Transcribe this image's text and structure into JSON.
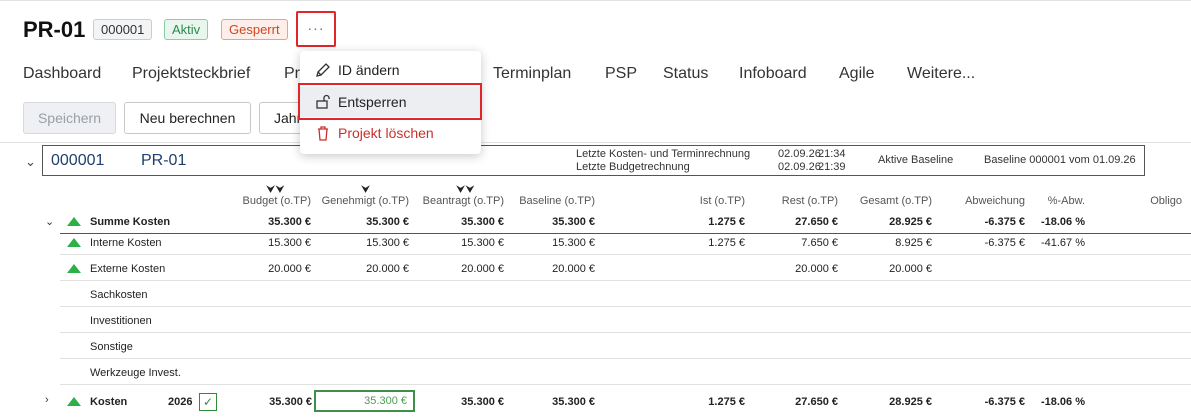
{
  "header": {
    "title": "PR-01",
    "badge_id": "000001",
    "badge_status": "Aktiv",
    "badge_lock": "Gesperrt",
    "more": "···"
  },
  "nav": {
    "items": [
      "Dashboard",
      "Projektsteckbrief",
      "Pr",
      "Terminplan",
      "PSP",
      "Status",
      "Infoboard",
      "Agile",
      "Weitere..."
    ]
  },
  "toolbar": {
    "save": "Speichern",
    "recalc": "Neu berechnen",
    "year": "Jahr"
  },
  "menu": {
    "items": [
      {
        "label": "ID ändern",
        "icon": "pencil-icon"
      },
      {
        "label": "Entsperren",
        "icon": "unlock-icon"
      },
      {
        "label": "Projekt löschen",
        "icon": "trash-icon"
      }
    ]
  },
  "project": {
    "id": "000001",
    "name": "PR-01",
    "last_calc_label": "Letzte Kosten- und Terminrechnung",
    "last_budget_label": "Letzte Budgetrechnung",
    "last_calc_date": "02.09.26",
    "last_calc_time": "21:34",
    "last_budget_date": "02.09.26",
    "last_budget_time": "21:39",
    "baseline_label": "Aktive Baseline",
    "baseline_value": "Baseline 000001 vom 01.09.26"
  },
  "table": {
    "headers": [
      "Budget (o.TP)",
      "Genehmigt (o.TP)",
      "Beantragt (o.TP)",
      "Baseline (o.TP)",
      "Ist (o.TP)",
      "Rest (o.TP)",
      "Gesamt (o.TP)",
      "Abweichung",
      "%-Abw.",
      "Obligo"
    ],
    "rows": [
      {
        "label": "Summe Kosten",
        "values": [
          "35.300 €",
          "35.300 €",
          "35.300 €",
          "35.300 €",
          "1.275 €",
          "27.650 €",
          "28.925 €",
          "-6.375 €",
          "-18.06 %"
        ]
      },
      {
        "label": "Interne Kosten",
        "values": [
          "15.300 €",
          "15.300 €",
          "15.300 €",
          "15.300 €",
          "1.275 €",
          "7.650 €",
          "8.925 €",
          "-6.375 €",
          "-41.67 %"
        ]
      },
      {
        "label": "Externe Kosten",
        "values": [
          "20.000 €",
          "20.000 €",
          "20.000 €",
          "20.000 €",
          "",
          "20.000 €",
          "20.000 €",
          "",
          ""
        ]
      },
      {
        "label": "Sachkosten",
        "values": [
          "",
          "",
          "",
          "",
          "",
          "",
          "",
          "",
          ""
        ]
      },
      {
        "label": "Investitionen",
        "values": [
          "",
          "",
          "",
          "",
          "",
          "",
          "",
          "",
          ""
        ]
      },
      {
        "label": "Sonstige",
        "values": [
          "",
          "",
          "",
          "",
          "",
          "",
          "",
          "",
          ""
        ]
      },
      {
        "label": "Werkzeuge Invest.",
        "values": [
          "",
          "",
          "",
          "",
          "",
          "",
          "",
          "",
          ""
        ]
      }
    ],
    "kosten_row": {
      "label": "Kosten",
      "year": "2026",
      "values": [
        "35.300 €",
        "35.300 €",
        "35.300 €",
        "35.300 €",
        "1.275 €",
        "27.650 €",
        "28.925 €",
        "-6.375 €",
        "-18.06 %"
      ]
    }
  }
}
